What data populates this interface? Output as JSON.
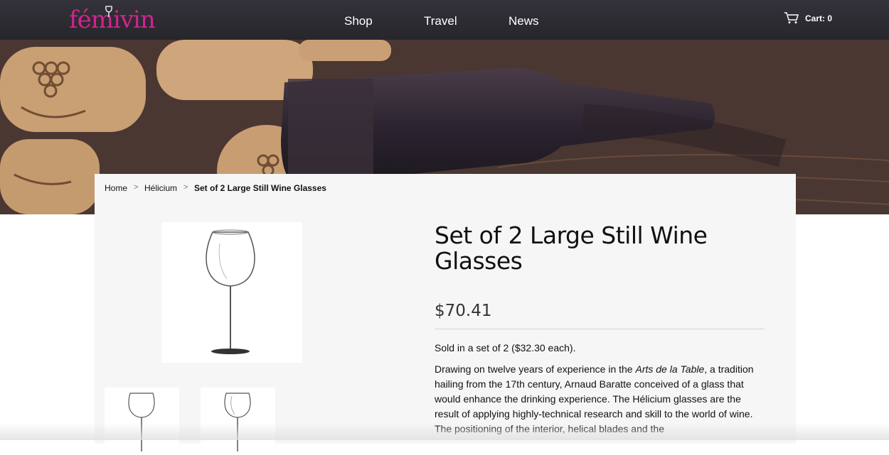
{
  "header": {
    "logo_text": "fémivin",
    "nav": [
      "Shop",
      "Travel",
      "News"
    ],
    "cart_label": "Cart: 0"
  },
  "breadcrumb": {
    "home": "Home",
    "sep": ">",
    "category": "Hélicium",
    "current": "Set of 2 Large Still Wine Glasses"
  },
  "product": {
    "title": "Set of 2 Large Still Wine Glasses",
    "price": "$70.41",
    "sold_note": "Sold in a set of 2 ($32.30 each).",
    "desc_1": "Drawing on twelve years of experience in the ",
    "desc_em": "Arts de la Table",
    "desc_2": ", a tradition hailing from the 17th century, Arnaud Baratte conceived of a glass that would enhance the drinking experience.  The Hélicium glasses are the result of applying highly-technical research and skill to the world of wine.  The positioning of the interior, helical blades and the"
  },
  "colors": {
    "brand": "#d3238f",
    "header_bg": "#2e2d33",
    "panel_bg": "#f6f6f6"
  },
  "icons": [
    "cart-icon",
    "wine-glass-logo-icon"
  ]
}
